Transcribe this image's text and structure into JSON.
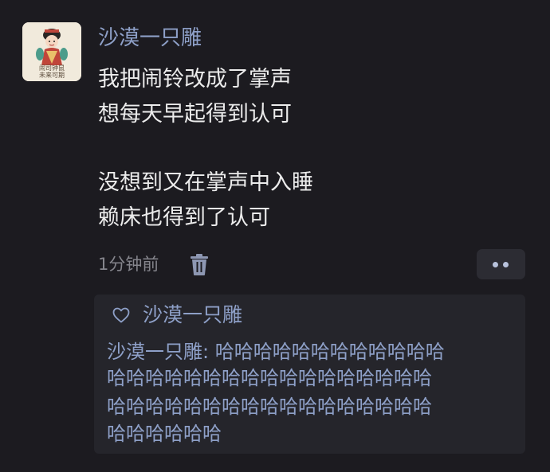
{
  "avatar": {
    "caption_line1": "闹司钟鼠",
    "caption_line2": "未来可期"
  },
  "post": {
    "author": "沙漠一只雕",
    "lines": [
      "我把闹铃改成了掌声",
      "想每天早起得到认可",
      "没想到又在掌声中入睡",
      "赖床也得到了认可"
    ],
    "time": "1分钟前"
  },
  "actions": {
    "delete_icon": "trash-icon",
    "more_icon": "more-dots-icon"
  },
  "likes": {
    "icon": "heart-outline-icon",
    "name": "沙漠一只雕"
  },
  "comment": {
    "lines": [
      "沙漠一只雕: 哈哈哈哈哈哈哈哈哈哈哈哈",
      "哈哈哈哈哈哈哈哈哈哈哈哈哈哈哈哈哈",
      "哈哈哈哈哈哈哈哈哈哈哈哈哈哈哈哈哈",
      "哈哈哈哈哈哈"
    ]
  },
  "colors": {
    "background": "#1c1b20",
    "name_link": "#8ea0c8",
    "body_text": "#ececec",
    "meta_text": "#85858c",
    "panel": "#25252b"
  }
}
